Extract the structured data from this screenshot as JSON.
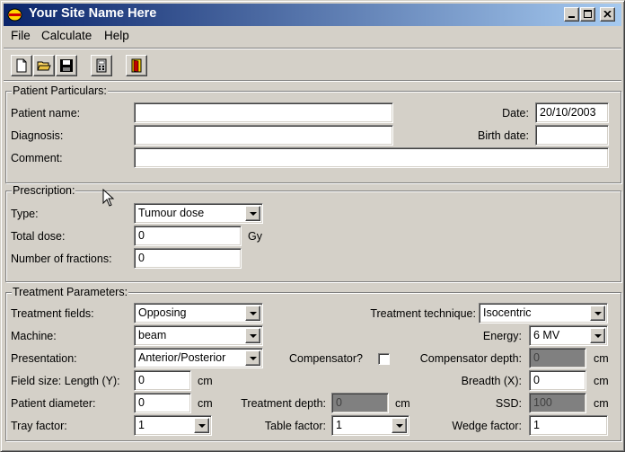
{
  "window": {
    "title": "Your Site Name Here"
  },
  "menu": [
    "File",
    "Calculate",
    "Help"
  ],
  "toolbar": [
    "new-document-icon",
    "open-folder-icon",
    "save-disk-icon",
    "calculator-icon",
    "exit-door-icon"
  ],
  "patient": {
    "legend": "Patient Particulars:",
    "name_label": "Patient name:",
    "name_value": "",
    "diagnosis_label": "Diagnosis:",
    "diagnosis_value": "",
    "comment_label": "Comment:",
    "comment_value": "",
    "date_label": "Date:",
    "date_value": "20/10/2003",
    "birth_label": "Birth date:",
    "birth_value": ""
  },
  "prescription": {
    "legend": "Prescription:",
    "type_label": "Type:",
    "type_value": "Tumour dose",
    "total_label": "Total dose:",
    "total_value": "0",
    "total_unit": "Gy",
    "fractions_label": "Number of fractions:",
    "fractions_value": "0"
  },
  "treatment": {
    "legend": "Treatment Parameters:",
    "fields_label": "Treatment fields:",
    "fields_value": "Opposing",
    "machine_label": "Machine:",
    "machine_value": "beam",
    "presentation_label": "Presentation:",
    "presentation_value": "Anterior/Posterior",
    "fieldsize_label": "Field size: Length (Y):",
    "fieldsize_value": "0",
    "fieldsize_unit": "cm",
    "diameter_label": "Patient diameter:",
    "diameter_value": "0",
    "diameter_unit": "cm",
    "tray_label": "Tray factor:",
    "tray_value": "1",
    "technique_label": "Treatment technique:",
    "technique_value": "Isocentric",
    "energy_label": "Energy:",
    "energy_value": "6 MV",
    "compensator_label": "Compensator?",
    "comp_depth_label": "Compensator depth:",
    "comp_depth_value": "0",
    "comp_depth_unit": "cm",
    "breadth_label": "Breadth (X):",
    "breadth_value": "0",
    "breadth_unit": "cm",
    "depth_label": "Treatment depth:",
    "depth_value": "0",
    "depth_unit": "cm",
    "ssd_label": "SSD:",
    "ssd_value": "100",
    "ssd_unit": "cm",
    "table_label": "Table factor:",
    "table_value": "1",
    "wedge_label": "Wedge factor:",
    "wedge_value": "1"
  }
}
